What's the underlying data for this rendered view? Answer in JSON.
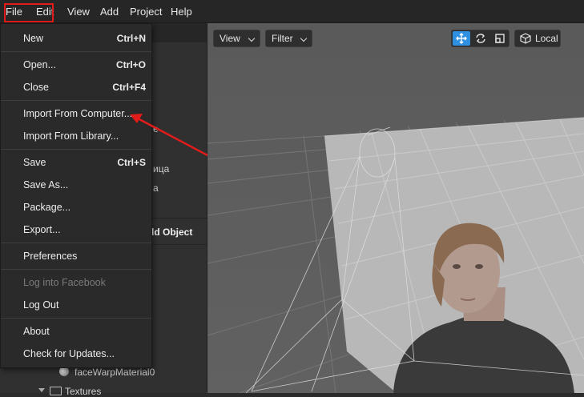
{
  "menubar": {
    "items": [
      "File",
      "Edit",
      "View",
      "Add",
      "Project",
      "Help"
    ]
  },
  "file_menu": {
    "items": [
      {
        "label": "New",
        "shortcut": "Ctrl+N"
      },
      {
        "label": "Open...",
        "shortcut": "Ctrl+O"
      },
      {
        "label": "Close",
        "shortcut": "Ctrl+F4"
      },
      {
        "label": "Import From Computer...",
        "shortcut": ""
      },
      {
        "label": "Import From Library...",
        "shortcut": ""
      },
      {
        "label": "Save",
        "shortcut": "Ctrl+S"
      },
      {
        "label": "Save As...",
        "shortcut": ""
      },
      {
        "label": "Package...",
        "shortcut": ""
      },
      {
        "label": "Export...",
        "shortcut": ""
      },
      {
        "label": "Preferences",
        "shortcut": ""
      },
      {
        "label": "Log into Facebook",
        "shortcut": "",
        "disabled": true
      },
      {
        "label": "Log Out",
        "shortcut": ""
      },
      {
        "label": "About",
        "shortcut": ""
      },
      {
        "label": "Check for Updates...",
        "shortcut": ""
      }
    ]
  },
  "left_panel": {
    "partial_1": "e",
    "partial_2": "ица",
    "partial_3": "а",
    "add_object_label": "dd Object",
    "material_label": "faceWarpMaterial0",
    "textures_label": "Textures"
  },
  "viewport": {
    "view_label": "View",
    "filter_label": "Filter",
    "local_label": "Local",
    "active_tool_color": "#2f8fe0"
  },
  "annotation_color": "#e21b1b"
}
